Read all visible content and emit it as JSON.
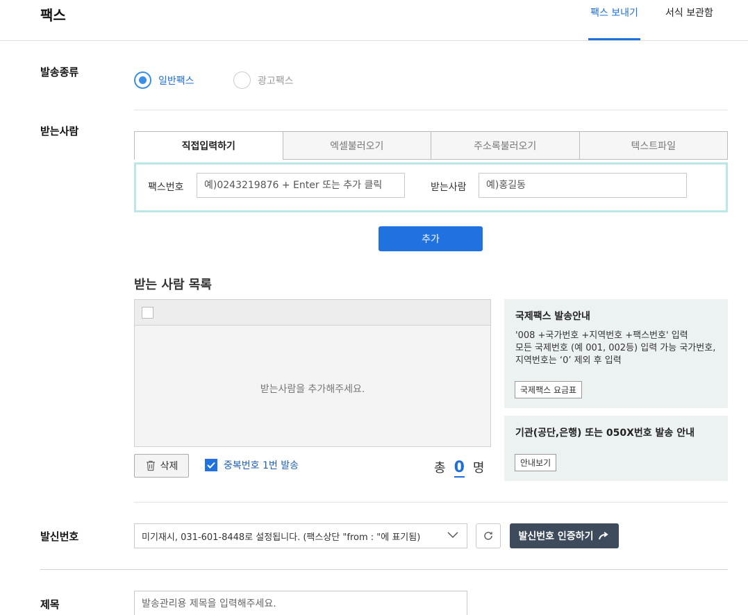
{
  "header": {
    "title": "팩스",
    "tabs": [
      {
        "label": "팩스 보내기",
        "active": true
      },
      {
        "label": "서식 보관함",
        "active": false
      }
    ]
  },
  "send_type": {
    "label": "발송종류",
    "options": [
      {
        "label": "일반팩스",
        "checked": true
      },
      {
        "label": "광고팩스",
        "checked": false
      }
    ]
  },
  "recipient": {
    "label": "받는사람",
    "tabs": [
      {
        "label": "직접입력하기",
        "active": true
      },
      {
        "label": "엑셀불러오기",
        "active": false
      },
      {
        "label": "주소록불러오기",
        "active": false
      },
      {
        "label": "텍스트파일",
        "active": false
      }
    ],
    "fax_label": "팩스번호",
    "fax_placeholder": "예)0243219876 + Enter 또는 추가 클릭",
    "name_label": "받는사람",
    "name_placeholder": "예)홍길동",
    "add_button": "추가"
  },
  "list": {
    "title": "받는 사람 목록",
    "empty_message": "받는사람을 추가해주세요.",
    "delete_button": "삭제",
    "dup_label": "중복번호 1번 발송",
    "dup_checked": true,
    "total_prefix": "총",
    "total_count": "0",
    "total_suffix": "명"
  },
  "info": {
    "intl_title": "국제팩스 발송안내",
    "intl_line1": "'008 +국가번호 +지역번호 +팩스번호' 입력",
    "intl_line2": "모든 국제번호 (예 001, 002등) 입력 가능 국가번호, 지역번호는 ‘0’ 제외 후 입력",
    "intl_button": "국제팩스 요금표",
    "org_title": "기관(공단,은행) 또는 050X번호 발송 안내",
    "org_button": "안내보기"
  },
  "sender": {
    "label": "발신번호",
    "selected": "미기재시, 031-601-8448로 설정됩니다. (팩스상단 \"from : \"에 표기됨)",
    "verify_button": "발신번호 인증하기"
  },
  "subject": {
    "label": "제목",
    "placeholder": "발송관리용 제목을 입력해주세요."
  },
  "colors": {
    "accent": "#1f72e0",
    "dark_button": "#3d4b5c",
    "input_highlight": "#b9e8e6",
    "info_bg": "#ecf1f2"
  }
}
